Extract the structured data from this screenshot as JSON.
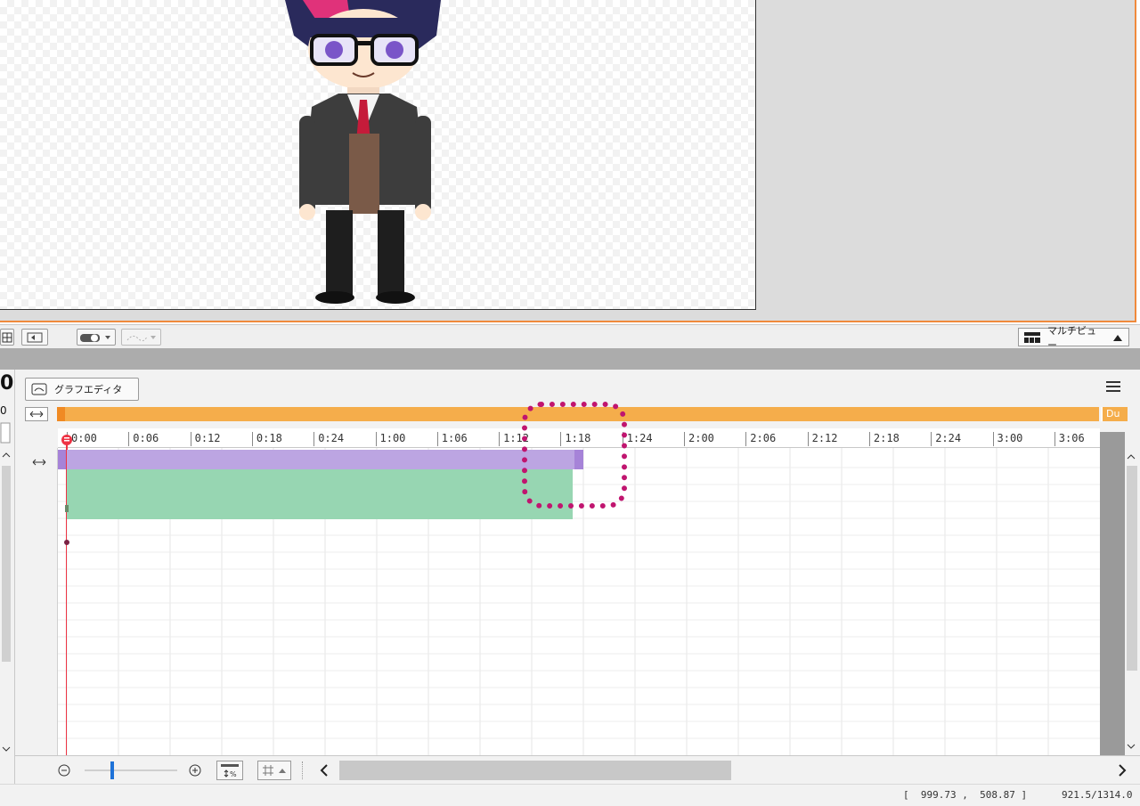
{
  "viewport_toolbar": {
    "multiview_label": "マルチビュー"
  },
  "timeline": {
    "graph_editor_label": "グラフエディタ",
    "range_end_label": "Du",
    "ruler_ticks": [
      "0:00",
      "0:06",
      "0:12",
      "0:18",
      "0:24",
      "1:00",
      "1:06",
      "1:12",
      "1:18",
      "1:24",
      "2:00",
      "2:06",
      "2:12",
      "2:18",
      "2:24",
      "3:00",
      "3:06"
    ],
    "clips": [
      {
        "name": "purple-clip",
        "color": "#bca5e2",
        "start": "0:00",
        "end": "1:18"
      },
      {
        "name": "green-clip",
        "color": "#97d6b2",
        "start": "0:00",
        "end": "1:17"
      }
    ],
    "playhead": "0:00"
  },
  "left_partial": {
    "big_digit": "0",
    "small_digit": "0"
  },
  "statusbar": {
    "coords": "[  999.73 ,  508.87 ]",
    "zoom_text": "921.5/1314.0"
  },
  "colors": {
    "accent_orange": "#f5ad4b",
    "playhead_red": "#ee3344",
    "highlight_magenta": "#c0156f",
    "zoom_blue": "#1e72d8"
  },
  "icons": [
    "graph-editor-icon",
    "expand-arrows-icon",
    "hamburger-menu-icon",
    "zoom-out-icon",
    "zoom-in-icon",
    "fit-percent-icon",
    "grid-icon",
    "chevron-left-icon",
    "chevron-right-icon",
    "multiview-icon",
    "triangle-up-icon",
    "playhead-knob-icon"
  ]
}
